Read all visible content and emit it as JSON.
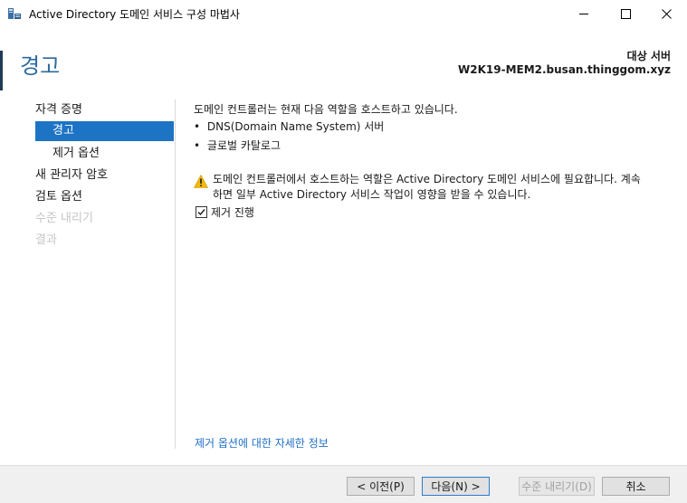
{
  "window": {
    "title": "Active Directory 도메인 서비스 구성 마법사"
  },
  "header": {
    "page_title": "경고",
    "target_label": "대상 서버",
    "target_name": "W2K19-MEM2.busan.thinggom.xyz"
  },
  "nav": {
    "items": [
      {
        "label": "자격 증명",
        "state": "normal"
      },
      {
        "label": "경고",
        "state": "active"
      },
      {
        "label": "제거 옵션",
        "state": "normal"
      },
      {
        "label": "새 관리자 암호",
        "state": "normal"
      },
      {
        "label": "검토 옵션",
        "state": "normal"
      },
      {
        "label": "수준 내리기",
        "state": "disabled"
      },
      {
        "label": "결과",
        "state": "disabled"
      }
    ]
  },
  "content": {
    "intro": "도메인 컨트롤러는 현재 다음 역할을 호스트하고 있습니다.",
    "roles": [
      "DNS(Domain Name System) 서버",
      "글로벌 카탈로그"
    ],
    "bullet": "•",
    "warning_line1": "도메인 컨트롤러에서 호스트하는 역할은 Active Directory 도메인 서비스에 필요합니다. 계속",
    "warning_line2": "하면 일부 Active Directory 서비스 작업이 영향을 받을 수 있습니다.",
    "checkbox_label": "제거 진행",
    "checkbox_checked": true,
    "more_info_link": "제거 옵션에 대한 자세한 정보"
  },
  "footer": {
    "prev_label": "< 이전(P)",
    "next_label": "다음(N) >",
    "uninstall_label": "수준 내리기(D)",
    "cancel_label": "취소"
  },
  "colors": {
    "accent": "#1d73c4",
    "title": "#2b6a9e",
    "link": "#1f6fc5",
    "warning": "#f2b80b"
  }
}
